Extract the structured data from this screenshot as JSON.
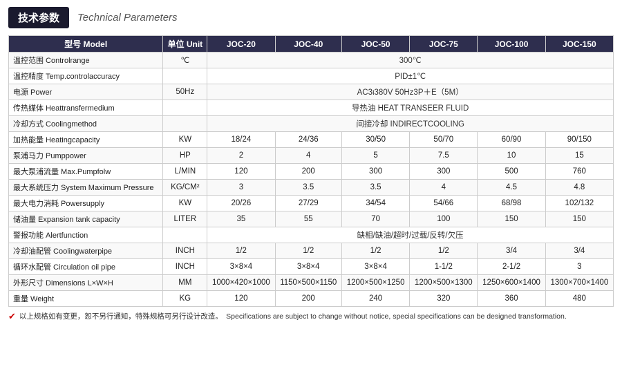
{
  "header": {
    "badge": "技术参数",
    "subtitle": "Technical Parameters"
  },
  "table": {
    "columns": [
      "型号 Model",
      "单位 Unit",
      "JOC-20",
      "JOC-40",
      "JOC-50",
      "JOC-75",
      "JOC-100",
      "JOC-150"
    ],
    "rows": [
      {
        "label": "温控范围 Controlrange",
        "unit": "℃",
        "values": [
          "300℃"
        ],
        "span": 6
      },
      {
        "label": "温控精度 Temp.controlaccuracy",
        "unit": "",
        "values": [
          "PID±1℃"
        ],
        "span": 6
      },
      {
        "label": "电源 Power",
        "unit": "50Hz",
        "values": [
          "AC3ι380V 50Hz3P＋E（5M）"
        ],
        "span": 6
      },
      {
        "label": "传热媒体 Heattransfermedium",
        "unit": "",
        "values": [
          "导热油 HEAT TRANSEER FLUID"
        ],
        "span": 6
      },
      {
        "label": "冷却方式 Coolingmethod",
        "unit": "",
        "values": [
          "间接冷却 INDIRECTCOOLING"
        ],
        "span": 6
      },
      {
        "label": "加热能量 Heatingcapacity",
        "unit": "KW",
        "values": [
          "18/24",
          "24/36",
          "30/50",
          "50/70",
          "60/90",
          "90/150"
        ],
        "span": 1
      },
      {
        "label": "泵浦马力 Pumppower",
        "unit": "HP",
        "values": [
          "2",
          "4",
          "5",
          "7.5",
          "10",
          "15"
        ],
        "span": 1
      },
      {
        "label": "最大泵浦流量 Max.Pumpfolw",
        "unit": "L/MIN",
        "values": [
          "120",
          "200",
          "300",
          "300",
          "500",
          "760"
        ],
        "span": 1
      },
      {
        "label": "最大系统压力 System Maximum Pressure",
        "unit": "KG/CM²",
        "values": [
          "3",
          "3.5",
          "3.5",
          "4",
          "4.5",
          "4.8"
        ],
        "span": 1
      },
      {
        "label": "最大电力消耗 Powersupply",
        "unit": "KW",
        "values": [
          "20/26",
          "27/29",
          "34/54",
          "54/66",
          "68/98",
          "102/132"
        ],
        "span": 1
      },
      {
        "label": "储油量 Expansion tank capacity",
        "unit": "LITER",
        "values": [
          "35",
          "55",
          "70",
          "100",
          "150",
          "150"
        ],
        "span": 1
      },
      {
        "label": "警报功能 Alertfunction",
        "unit": "",
        "values": [
          "缺相/缺油/超时/过载/反转/欠压"
        ],
        "span": 6
      },
      {
        "label": "冷却油配管 Coolingwaterpipe",
        "unit": "INCH",
        "values": [
          "1/2",
          "1/2",
          "1/2",
          "1/2",
          "3/4",
          "3/4"
        ],
        "span": 1
      },
      {
        "label": "循环水配管 Circulation oil pipe",
        "unit": "INCH",
        "values": [
          "3×8×4",
          "3×8×4",
          "3×8×4",
          "1-1/2",
          "2-1/2",
          "3"
        ],
        "span": 1
      },
      {
        "label": "外形尺寸 Dimensions L×W×H",
        "unit": "MM",
        "values": [
          "1000×420×1000",
          "1150×500×1150",
          "1200×500×1250",
          "1200×500×1300",
          "1250×600×1400",
          "1300×700×1400"
        ],
        "span": 1
      },
      {
        "label": "重量 Weight",
        "unit": "KG",
        "values": [
          "120",
          "200",
          "240",
          "320",
          "360",
          "480"
        ],
        "span": 1
      }
    ]
  },
  "footer": {
    "icon": "✔",
    "text_cn": "以上规格如有变更，恕不另行通知，特殊规格可另行设计改造。",
    "text_en": "Specifications are subject to change without notice, special specifications can be designed transformation."
  }
}
